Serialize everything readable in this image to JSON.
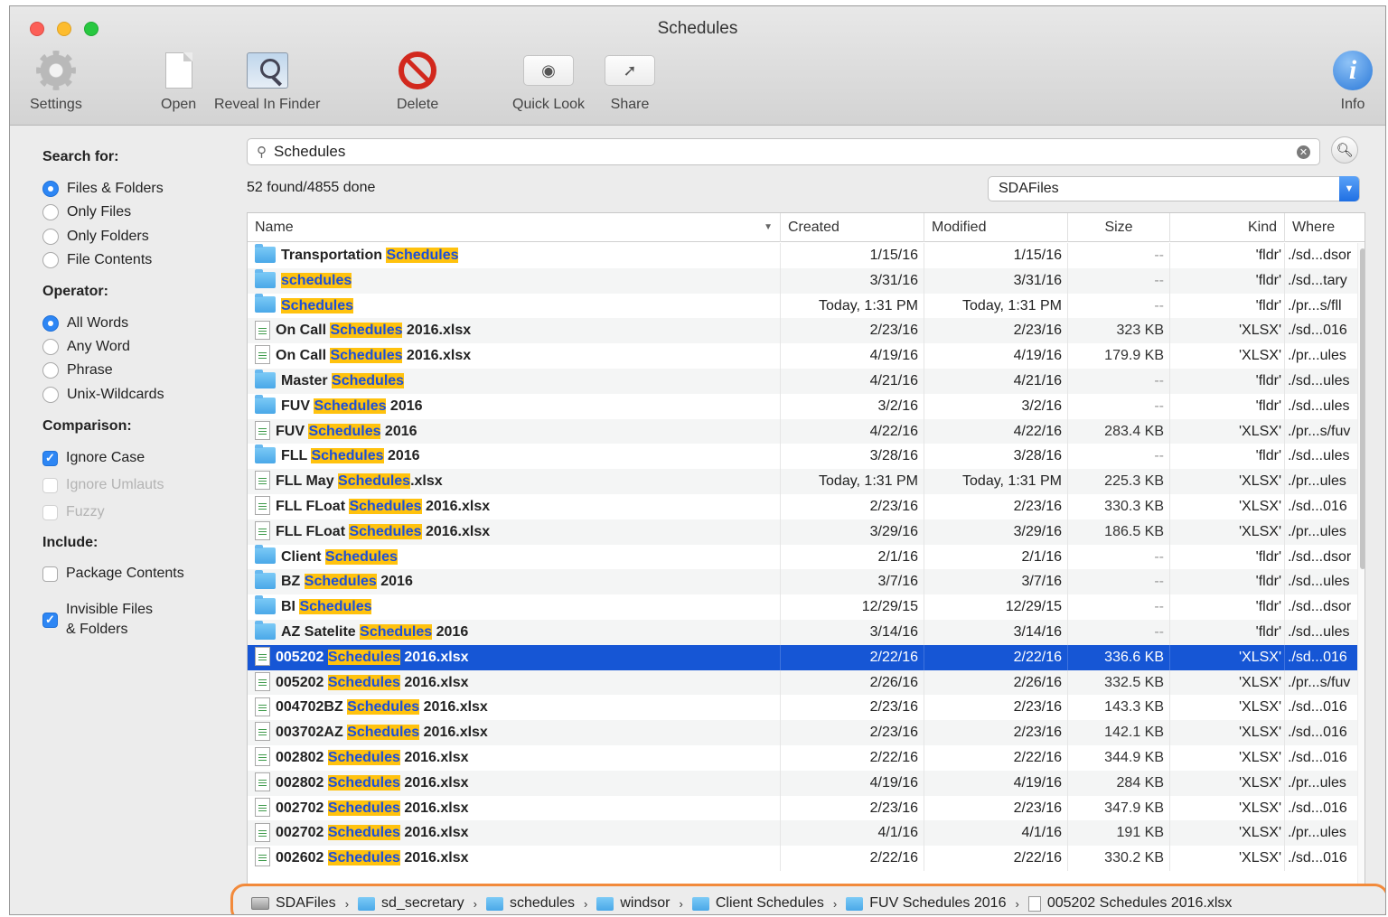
{
  "window": {
    "title": "Schedules"
  },
  "toolbar": {
    "settings_label": "Settings",
    "open_label": "Open",
    "reveal_label": "Reveal In Finder",
    "delete_label": "Delete",
    "quicklook_label": "Quick Look",
    "share_label": "Share",
    "info_label": "Info"
  },
  "sidebar": {
    "search_for_heading": "Search for:",
    "search_for_options": [
      {
        "label": "Files & Folders",
        "selected": true
      },
      {
        "label": "Only Files",
        "selected": false
      },
      {
        "label": "Only Folders",
        "selected": false
      },
      {
        "label": "File Contents",
        "selected": false
      }
    ],
    "operator_heading": "Operator:",
    "operator_options": [
      {
        "label": "All Words",
        "selected": true
      },
      {
        "label": "Any Word",
        "selected": false
      },
      {
        "label": "Phrase",
        "selected": false
      },
      {
        "label": "Unix-Wildcards",
        "selected": false
      }
    ],
    "comparison_heading": "Comparison:",
    "comparison_options": [
      {
        "label": "Ignore Case",
        "checked": true,
        "enabled": true
      },
      {
        "label": "Ignore Umlauts",
        "checked": false,
        "enabled": false
      },
      {
        "label": "Fuzzy",
        "checked": false,
        "enabled": false
      }
    ],
    "include_heading": "Include:",
    "include_options": [
      {
        "label": "Package Contents",
        "checked": false
      },
      {
        "label_line1": "Invisible Files",
        "label_line2": "& Folders",
        "checked": true
      }
    ]
  },
  "search": {
    "query": "Schedules",
    "status": "52 found/4855 done",
    "scope": "SDAFiles"
  },
  "table": {
    "columns": {
      "name": "Name",
      "created": "Created",
      "modified": "Modified",
      "size": "Size",
      "kind": "Kind",
      "where": "Where"
    },
    "highlight_term": "Schedules",
    "rows": [
      {
        "icon": "folder",
        "name_pre": "Transportation ",
        "name_match": "Schedules",
        "name_post": "",
        "created": "1/15/16",
        "modified": "1/15/16",
        "size": "--",
        "kind": "'fldr'",
        "where": "./sd...dsor"
      },
      {
        "icon": "folder",
        "name_pre": "",
        "name_match": "schedules",
        "name_post": "",
        "created": "3/31/16",
        "modified": "3/31/16",
        "size": "--",
        "kind": "'fldr'",
        "where": "./sd...tary"
      },
      {
        "icon": "folder",
        "name_pre": "",
        "name_match": "Schedules",
        "name_post": "",
        "created": "Today, 1:31 PM",
        "modified": "Today, 1:31 PM",
        "size": "--",
        "kind": "'fldr'",
        "where": "./pr...s/fll"
      },
      {
        "icon": "xlsx",
        "name_pre": "On Call ",
        "name_match": "Schedules",
        "name_post": " 2016.xlsx",
        "created": "2/23/16",
        "modified": "2/23/16",
        "size": "323 KB",
        "kind": "'XLSX'",
        "where": "./sd...016"
      },
      {
        "icon": "xlsx",
        "name_pre": "On Call ",
        "name_match": "Schedules",
        "name_post": " 2016.xlsx",
        "created": "4/19/16",
        "modified": "4/19/16",
        "size": "179.9 KB",
        "kind": "'XLSX'",
        "where": "./pr...ules"
      },
      {
        "icon": "folder",
        "name_pre": "Master ",
        "name_match": "Schedules",
        "name_post": "",
        "created": "4/21/16",
        "modified": "4/21/16",
        "size": "--",
        "kind": "'fldr'",
        "where": "./sd...ules"
      },
      {
        "icon": "folder",
        "name_pre": "FUV ",
        "name_match": "Schedules",
        "name_post": " 2016",
        "created": "3/2/16",
        "modified": "3/2/16",
        "size": "--",
        "kind": "'fldr'",
        "where": "./sd...ules"
      },
      {
        "icon": "xlsx",
        "name_pre": "FUV ",
        "name_match": "Schedules",
        "name_post": " 2016",
        "created": "4/22/16",
        "modified": "4/22/16",
        "size": "283.4 KB",
        "kind": "'XLSX'",
        "where": "./pr...s/fuv"
      },
      {
        "icon": "folder",
        "name_pre": "FLL ",
        "name_match": "Schedules",
        "name_post": " 2016",
        "created": "3/28/16",
        "modified": "3/28/16",
        "size": "--",
        "kind": "'fldr'",
        "where": "./sd...ules"
      },
      {
        "icon": "xlsx",
        "name_pre": "FLL May ",
        "name_match": "Schedules",
        "name_post": ".xlsx",
        "created": "Today, 1:31 PM",
        "modified": "Today, 1:31 PM",
        "size": "225.3 KB",
        "kind": "'XLSX'",
        "where": "./pr...ules"
      },
      {
        "icon": "xlsx",
        "name_pre": "FLL FLoat ",
        "name_match": "Schedules",
        "name_post": " 2016.xlsx",
        "created": "2/23/16",
        "modified": "2/23/16",
        "size": "330.3 KB",
        "kind": "'XLSX'",
        "where": "./sd...016"
      },
      {
        "icon": "xlsx",
        "name_pre": "FLL FLoat ",
        "name_match": "Schedules",
        "name_post": " 2016.xlsx",
        "created": "3/29/16",
        "modified": "3/29/16",
        "size": "186.5 KB",
        "kind": "'XLSX'",
        "where": "./pr...ules"
      },
      {
        "icon": "folder",
        "name_pre": "Client ",
        "name_match": "Schedules",
        "name_post": "",
        "created": "2/1/16",
        "modified": "2/1/16",
        "size": "--",
        "kind": "'fldr'",
        "where": "./sd...dsor"
      },
      {
        "icon": "folder",
        "name_pre": "BZ ",
        "name_match": "Schedules",
        "name_post": " 2016",
        "created": "3/7/16",
        "modified": "3/7/16",
        "size": "--",
        "kind": "'fldr'",
        "where": "./sd...ules"
      },
      {
        "icon": "folder",
        "name_pre": "BI ",
        "name_match": "Schedules",
        "name_post": "",
        "created": "12/29/15",
        "modified": "12/29/15",
        "size": "--",
        "kind": "'fldr'",
        "where": "./sd...dsor"
      },
      {
        "icon": "folder",
        "name_pre": "AZ Satelite ",
        "name_match": "Schedules",
        "name_post": " 2016",
        "created": "3/14/16",
        "modified": "3/14/16",
        "size": "--",
        "kind": "'fldr'",
        "where": "./sd...ules"
      },
      {
        "icon": "xlsx",
        "name_pre": "005202 ",
        "name_match": "Schedules",
        "name_post": " 2016.xlsx",
        "created": "2/22/16",
        "modified": "2/22/16",
        "size": "336.6 KB",
        "kind": "'XLSX'",
        "where": "./sd...016",
        "selected": true
      },
      {
        "icon": "xlsx",
        "name_pre": "005202 ",
        "name_match": "Schedules",
        "name_post": " 2016.xlsx",
        "created": "2/26/16",
        "modified": "2/26/16",
        "size": "332.5 KB",
        "kind": "'XLSX'",
        "where": "./pr...s/fuv"
      },
      {
        "icon": "xlsx",
        "name_pre": "004702BZ ",
        "name_match": "Schedules",
        "name_post": " 2016.xlsx",
        "created": "2/23/16",
        "modified": "2/23/16",
        "size": "143.3 KB",
        "kind": "'XLSX'",
        "where": "./sd...016"
      },
      {
        "icon": "xlsx",
        "name_pre": "003702AZ ",
        "name_match": "Schedules",
        "name_post": " 2016.xlsx",
        "created": "2/23/16",
        "modified": "2/23/16",
        "size": "142.1 KB",
        "kind": "'XLSX'",
        "where": "./sd...016"
      },
      {
        "icon": "xlsx",
        "name_pre": "002802 ",
        "name_match": "Schedules",
        "name_post": " 2016.xlsx",
        "created": "2/22/16",
        "modified": "2/22/16",
        "size": "344.9 KB",
        "kind": "'XLSX'",
        "where": "./sd...016"
      },
      {
        "icon": "xlsx",
        "name_pre": "002802 ",
        "name_match": "Schedules",
        "name_post": " 2016.xlsx",
        "created": "4/19/16",
        "modified": "4/19/16",
        "size": "284 KB",
        "kind": "'XLSX'",
        "where": "./pr...ules"
      },
      {
        "icon": "xlsx",
        "name_pre": "002702 ",
        "name_match": "Schedules",
        "name_post": " 2016.xlsx",
        "created": "2/23/16",
        "modified": "2/23/16",
        "size": "347.9 KB",
        "kind": "'XLSX'",
        "where": "./sd...016"
      },
      {
        "icon": "xlsx",
        "name_pre": "002702 ",
        "name_match": "Schedules",
        "name_post": " 2016.xlsx",
        "created": "4/1/16",
        "modified": "4/1/16",
        "size": "191 KB",
        "kind": "'XLSX'",
        "where": "./pr...ules"
      },
      {
        "icon": "xlsx",
        "name_pre": "002602 ",
        "name_match": "Schedules",
        "name_post": " 2016.xlsx",
        "created": "2/22/16",
        "modified": "2/22/16",
        "size": "330.2 KB",
        "kind": "'XLSX'",
        "where": "./sd...016"
      }
    ]
  },
  "pathbar": {
    "items": [
      {
        "icon": "disk",
        "label": "SDAFiles"
      },
      {
        "icon": "folder",
        "label": "sd_secretary"
      },
      {
        "icon": "folder",
        "label": "schedules"
      },
      {
        "icon": "folder",
        "label": "windsor"
      },
      {
        "icon": "folder",
        "label": "Client Schedules"
      },
      {
        "icon": "folder",
        "label": "FUV Schedules 2016"
      },
      {
        "icon": "xlsx",
        "label": "005202 Schedules 2016.xlsx"
      }
    ],
    "separator": "›"
  },
  "colors": {
    "selection": "#1656d5",
    "highlight_bg": "#ffc20e",
    "highlight_fg": "#1c4fd9",
    "accent": "#2d86f4",
    "pathbar_outline": "#f28a3b"
  }
}
